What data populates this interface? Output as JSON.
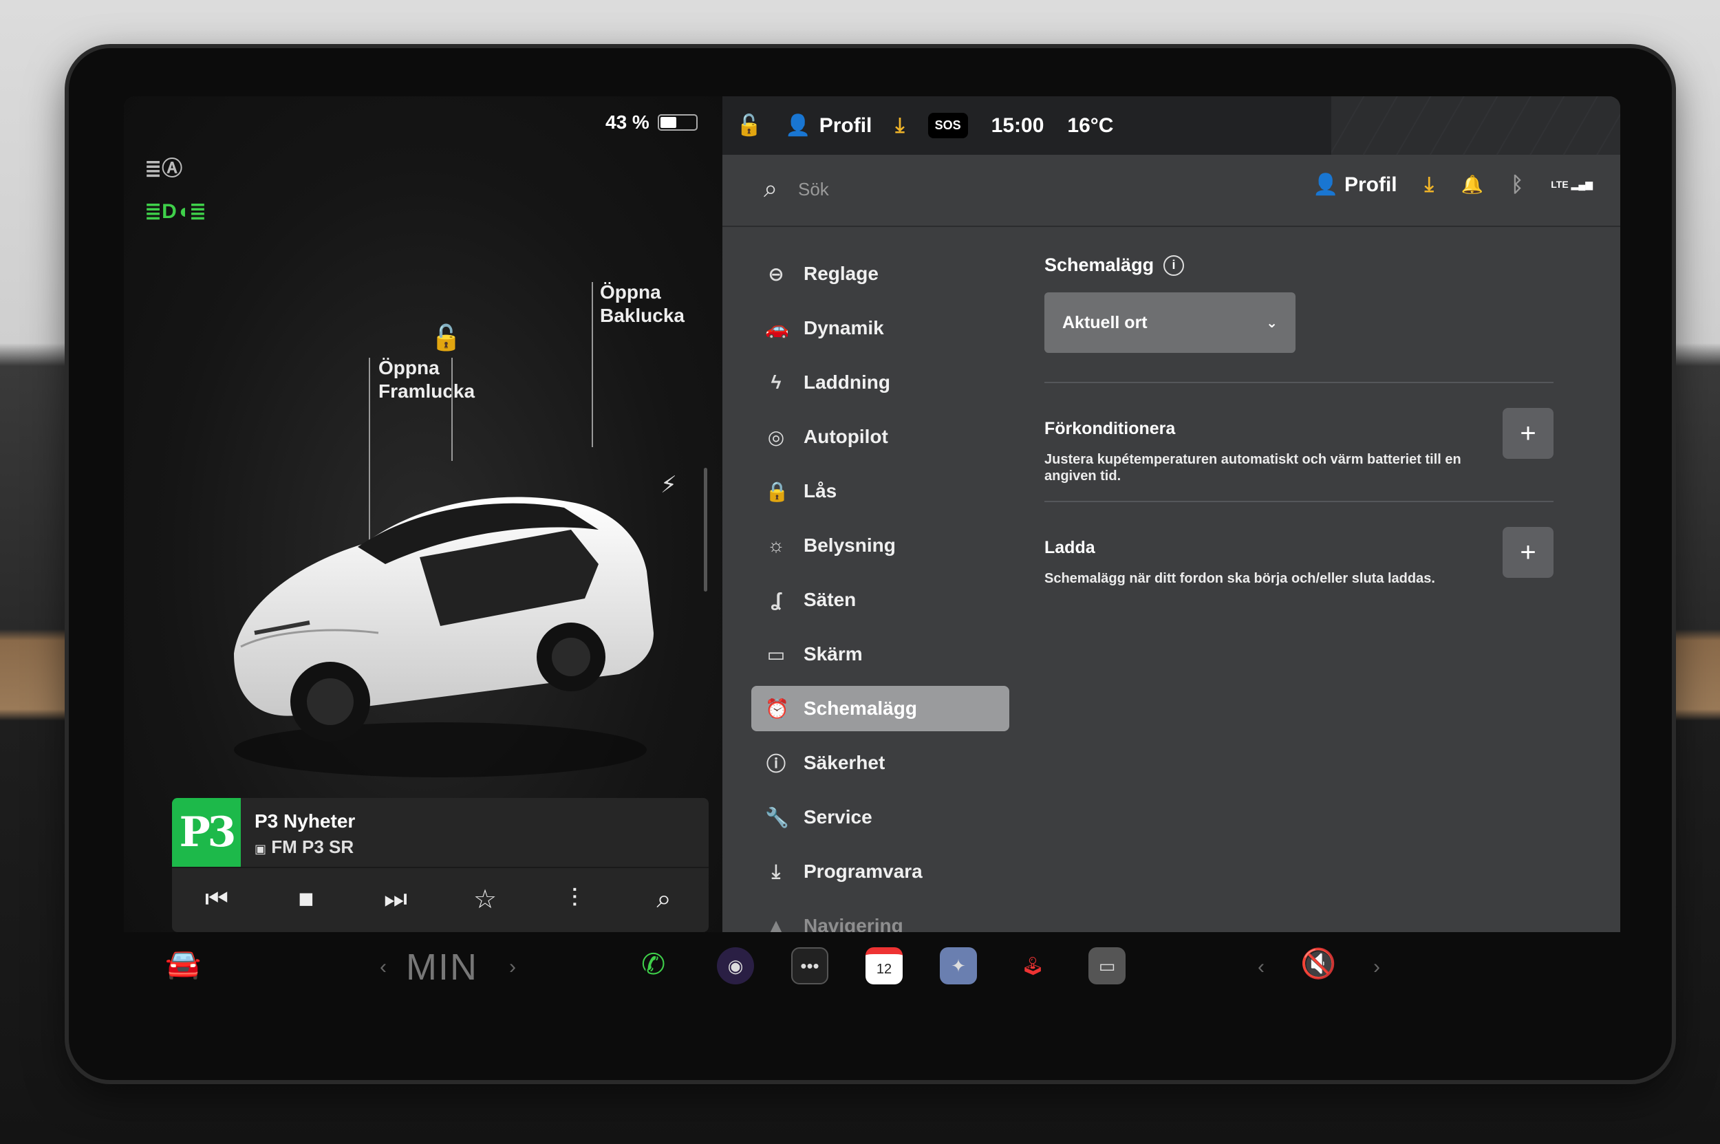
{
  "left_panel": {
    "battery_percent_label": "43 %",
    "battery_level": 0.43,
    "callout_front": "Öppna\nFramlucka",
    "callout_trunk": "Öppna\nBaklucka"
  },
  "media": {
    "logo_text": "P3",
    "station_name": "P3 Nyheter",
    "source": "FM P3 SR"
  },
  "statusbar": {
    "profile_label": "Profil",
    "sos_label": "SOS",
    "time": "15:00",
    "temperature": "16°C"
  },
  "search": {
    "placeholder": "Sök",
    "profile_label": "Profil",
    "lte_label": "LTE"
  },
  "menu": {
    "items": [
      {
        "label": "Reglage",
        "icon": "toggle-icon"
      },
      {
        "label": "Dynamik",
        "icon": "car-icon"
      },
      {
        "label": "Laddning",
        "icon": "bolt-icon"
      },
      {
        "label": "Autopilot",
        "icon": "steering-wheel-icon"
      },
      {
        "label": "Lås",
        "icon": "lock-icon"
      },
      {
        "label": "Belysning",
        "icon": "sun-icon"
      },
      {
        "label": "Säten",
        "icon": "seat-icon"
      },
      {
        "label": "Skärm",
        "icon": "display-icon"
      },
      {
        "label": "Schemalägg",
        "icon": "alarm-clock-icon",
        "active": true
      },
      {
        "label": "Säkerhet",
        "icon": "alert-icon"
      },
      {
        "label": "Service",
        "icon": "wrench-icon"
      },
      {
        "label": "Programvara",
        "icon": "download-icon"
      },
      {
        "label": "Navigering",
        "icon": "navigation-icon"
      }
    ]
  },
  "content": {
    "schedule_title": "Schemalägg",
    "location_dropdown": "Aktuell ort",
    "precondition_title": "Förkonditionera",
    "precondition_desc": "Justera kupétemperaturen automatiskt och värm batteriet till en angiven tid.",
    "charge_title": "Ladda",
    "charge_desc": "Schemalägg när ditt fordon ska börja och/eller sluta laddas."
  },
  "dock": {
    "climate_label": "MIN",
    "calendar_day": "12"
  },
  "colors": {
    "accent_green": "#3fd04a",
    "download_orange": "#f0b429",
    "active_menu": "#9a9b9d",
    "panel_bg": "#3d3e40"
  }
}
